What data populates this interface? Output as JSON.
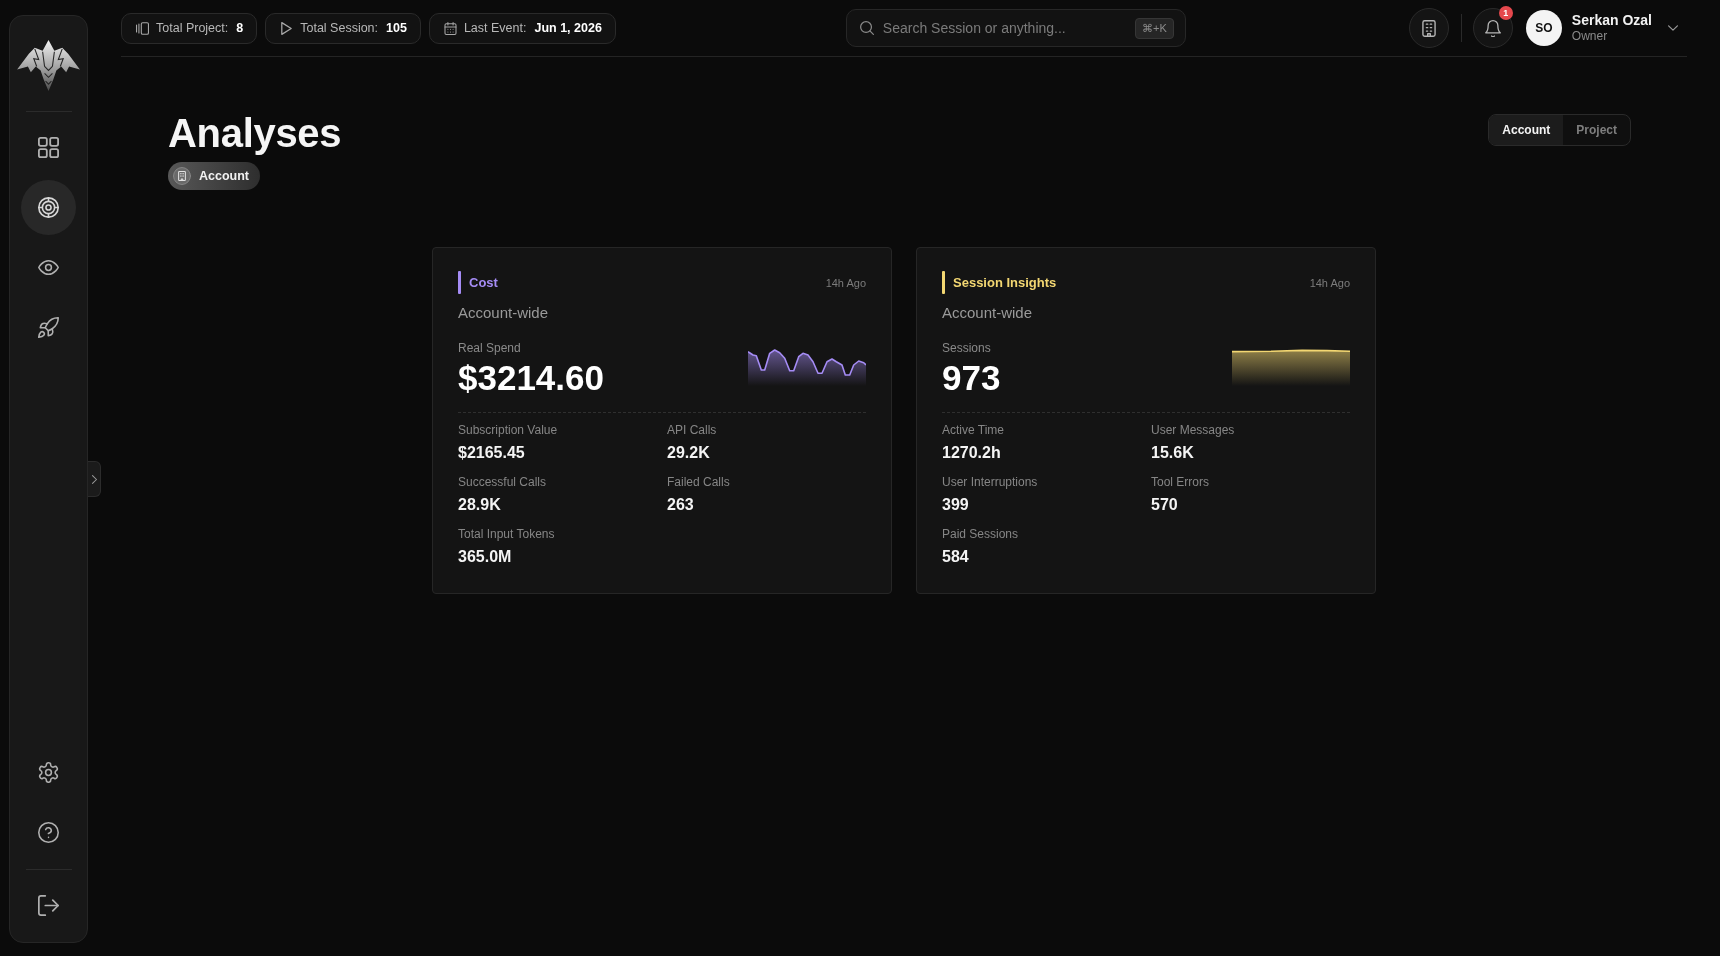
{
  "sidebar": {
    "nav_items": [
      {
        "selected": false
      },
      {
        "selected": true
      },
      {
        "selected": false
      },
      {
        "selected": false
      }
    ]
  },
  "top_bar": {
    "stats": [
      {
        "label": "Total Project:",
        "value": "8"
      },
      {
        "label": "Total Session:",
        "value": "105"
      },
      {
        "label": "Last Event:",
        "value": "Jun 1, 2026"
      }
    ],
    "search": {
      "placeholder": "Search Session or anything...",
      "shortcut": "⌘+K"
    },
    "notifications": {
      "badge": "1"
    },
    "user": {
      "initials": "SO",
      "name": "Serkan Ozal",
      "role": "Owner"
    }
  },
  "page": {
    "title": "Analyses",
    "scope_badge": "Account",
    "scope_toggle": [
      {
        "label": "Account",
        "selected": true
      },
      {
        "label": "Project",
        "selected": false
      }
    ]
  },
  "cards": [
    {
      "title": "Cost",
      "color": "#a58cf5",
      "time": "14h Ago",
      "subtitle": "Account-wide",
      "headline_label": "Real Spend",
      "headline_value": "$3214.60",
      "metrics": [
        {
          "label": "Subscription Value",
          "value": "$2165.45"
        },
        {
          "label": "API Calls",
          "value": "29.2K"
        },
        {
          "label": "Successful Calls",
          "value": "28.9K"
        },
        {
          "label": "Failed Calls",
          "value": "263"
        },
        {
          "label": "Total Input Tokens",
          "value": "365.0M"
        }
      ]
    },
    {
      "title": "Session Insights",
      "color": "#f3d772",
      "time": "14h Ago",
      "subtitle": "Account-wide",
      "headline_label": "Sessions",
      "headline_value": "973",
      "metrics": [
        {
          "label": "Active Time",
          "value": "1270.2h"
        },
        {
          "label": "User Messages",
          "value": "15.6K"
        },
        {
          "label": "User Interruptions",
          "value": "399"
        },
        {
          "label": "Tool Errors",
          "value": "570"
        },
        {
          "label": "Paid Sessions",
          "value": "584"
        }
      ]
    }
  ]
}
